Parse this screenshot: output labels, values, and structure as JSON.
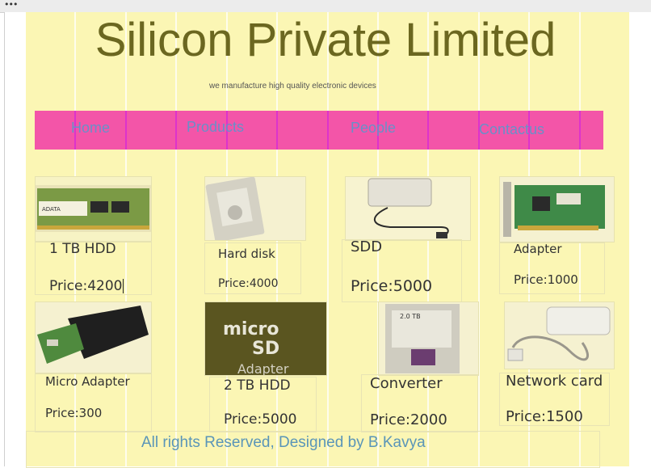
{
  "browser": {
    "menu_icon": "ellipsis-icon",
    "menu_label": "•••"
  },
  "header": {
    "title": "Silicon Private Limited",
    "tagline": "we manufacture high quality electronic devices"
  },
  "nav": {
    "items": [
      "Home",
      "Products",
      "People",
      "Contactus"
    ]
  },
  "products": [
    {
      "name": "1 TB HDD",
      "price": "Price:4200",
      "image": "ram-module-image"
    },
    {
      "name": "Hard disk",
      "price": "Price:4000",
      "image": "hard-disk-image"
    },
    {
      "name": "SDD",
      "price": "Price:5000",
      "image": "external-drive-image"
    },
    {
      "name": "Adapter",
      "price": "Price:1000",
      "image": "network-adapter-card-image"
    },
    {
      "name": "Micro Adapter",
      "price": "Price:300",
      "image": "drive-enclosure-image"
    },
    {
      "name": "2 TB HDD",
      "price": "Price:5000",
      "image": "microsd-adapter-image"
    },
    {
      "name": "Converter",
      "price": "Price:2000",
      "image": "sata-drive-image"
    },
    {
      "name": "Network card",
      "price": "Price:1500",
      "image": "power-adapter-image"
    }
  ],
  "footer": {
    "text": "All rights Reserved, Designed by B.Kavya"
  },
  "colors": {
    "background": "#fbf6b4",
    "nav": "#f355a8",
    "title": "#6b6720",
    "nav_text": "#6a8fc8",
    "footer_text": "#5a95b8"
  }
}
